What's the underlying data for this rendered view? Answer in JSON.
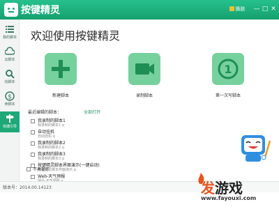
{
  "titlebar": {
    "title": "按键精灵",
    "skin_label": "换肤",
    "minimize": "—",
    "maximize": "□",
    "close": "✕"
  },
  "sidebar": {
    "items": [
      {
        "label": "我的脚本",
        "icon": "list-icon"
      },
      {
        "label": "云脚本",
        "icon": "cloud-icon"
      },
      {
        "label": "找脚本",
        "icon": "search-icon"
      },
      {
        "label": "卖脚本",
        "icon": "dollar-icon"
      },
      {
        "label": "快捷引导",
        "icon": "signpost-icon"
      }
    ]
  },
  "main": {
    "welcome": "欢迎使用按键精灵",
    "tiles": [
      {
        "label": "新建脚本",
        "icon": "plus-icon"
      },
      {
        "label": "录制脚本",
        "icon": "video-camera-icon"
      },
      {
        "label": "第一次写脚本",
        "icon": "number-one-icon",
        "badge": "1"
      }
    ],
    "recent_header": "最近编辑的脚本：",
    "open_all": "全部打开",
    "recent_scripts": [
      {
        "title": "我录制的脚本1",
        "sub": "我录制的脚本1.q"
      },
      {
        "title": "自动挂机",
        "sub": "自动挂机.q"
      },
      {
        "title": "我录制的脚本2",
        "sub": "我录制的脚本2.q"
      },
      {
        "title": "我录制的脚本3",
        "sub": "我录制的脚本3.q"
      },
      {
        "title": "按键精灵脚本界面演示(一键启动)",
        "sub": "按键精灵脚本界面演示.q"
      },
      {
        "title": "Web-天气预报",
        "sub": "网页-天气预报.q"
      }
    ],
    "no_remind": "不再提示"
  },
  "statusbar": {
    "version": "版本号：2014.00.14123"
  },
  "watermark": {
    "brand_hl": "发",
    "brand_rest": "游戏",
    "url": "www.fayouxi.com"
  },
  "colors": {
    "accent": "#1ea877",
    "tile": "#76d19d",
    "watermark": "#e8531d"
  }
}
